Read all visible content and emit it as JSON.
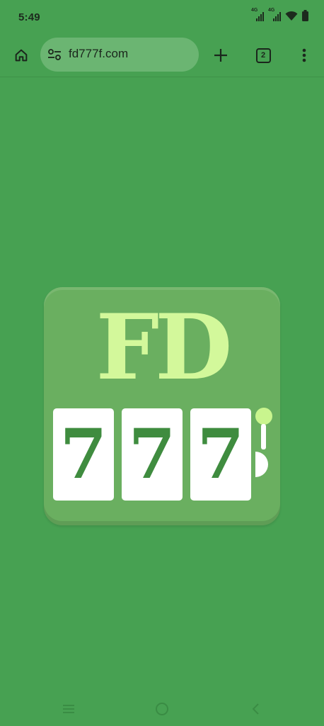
{
  "status_bar": {
    "time": "5:49",
    "signal_1_label": "4G",
    "signal_2_label": "4G",
    "icons": [
      "signal-icon",
      "signal-icon",
      "wifi-icon",
      "battery-icon"
    ]
  },
  "browser": {
    "url": "fd777f.com",
    "tab_count": "2",
    "icons": [
      "home-icon",
      "site-settings-icon",
      "plus-icon",
      "tab-switcher-icon",
      "more-vert-icon"
    ]
  },
  "logo": {
    "title": "FD",
    "reels": [
      "7",
      "7",
      "7"
    ],
    "colors": {
      "background": "#47a152",
      "tile": "#6aaf60",
      "title": "#d3f89b",
      "reel_digit": "#3f8c3f"
    }
  },
  "nav_bar": {
    "icons": [
      "recents-icon",
      "home-circle-icon",
      "back-icon"
    ]
  }
}
